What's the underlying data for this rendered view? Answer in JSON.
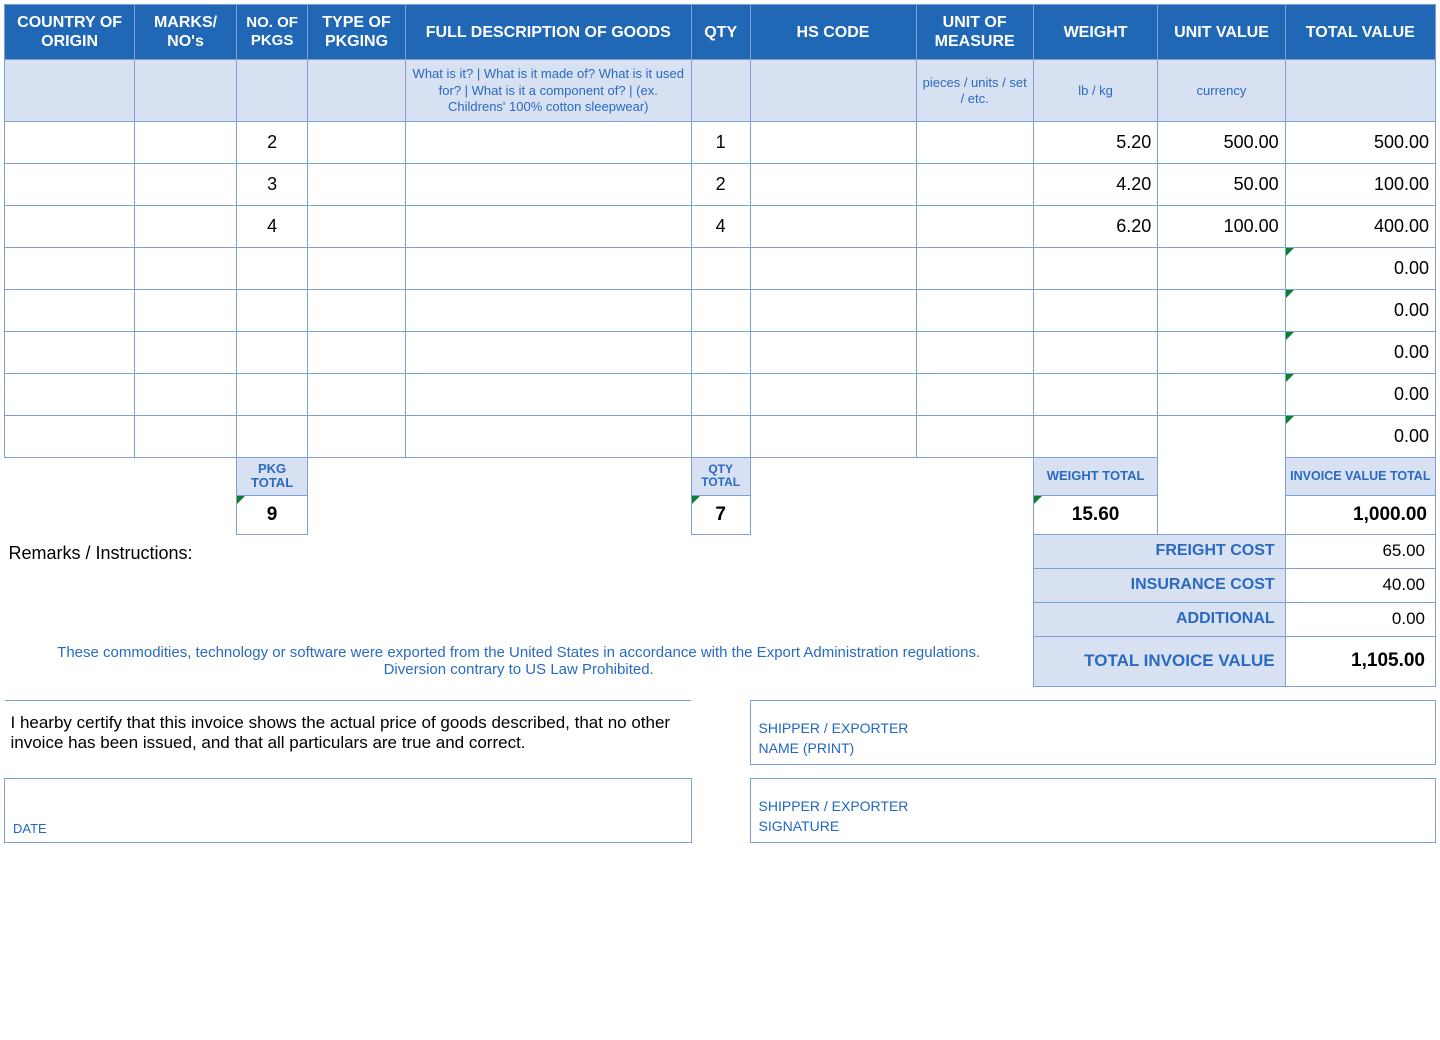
{
  "headers": {
    "country": "COUNTRY OF ORIGIN",
    "marks": "MARKS/ NO's",
    "pkgs": "NO. OF PKGS",
    "pkging": "TYPE OF PKGING",
    "desc": "FULL DESCRIPTION OF GOODS",
    "qty": "QTY",
    "hs": "HS CODE",
    "uom": "UNIT OF MEASURE",
    "weight": "WEIGHT",
    "unitval": "UNIT VALUE",
    "totalval": "TOTAL VALUE"
  },
  "hints": {
    "desc": "What is it? | What is it made of? What is it used for? | What is it a component of? | (ex. Childrens' 100% cotton sleepwear)",
    "uom": "pieces / units / set / etc.",
    "weight": "lb / kg",
    "unitval": "currency"
  },
  "rows": [
    {
      "pkgs": "2",
      "qty": "1",
      "weight": "5.20",
      "unitval": "500.00",
      "totalval": "500.00"
    },
    {
      "pkgs": "3",
      "qty": "2",
      "weight": "4.20",
      "unitval": "50.00",
      "totalval": "100.00"
    },
    {
      "pkgs": "4",
      "qty": "4",
      "weight": "6.20",
      "unitval": "100.00",
      "totalval": "400.00"
    },
    {
      "totalval": "0.00"
    },
    {
      "totalval": "0.00"
    },
    {
      "totalval": "0.00"
    },
    {
      "totalval": "0.00"
    },
    {
      "totalval": "0.00"
    }
  ],
  "totals": {
    "pkg_label": "PKG TOTAL",
    "qty_label": "QTY TOTAL",
    "weight_label": "WEIGHT TOTAL",
    "invval_label": "INVOICE VALUE TOTAL",
    "pkg": "9",
    "qty": "7",
    "weight": "15.60",
    "invval": "1,000.00"
  },
  "summary": {
    "freight_label": "FREIGHT COST",
    "freight": "65.00",
    "insurance_label": "INSURANCE COST",
    "insurance": "40.00",
    "additional_label": "ADDITIONAL",
    "additional": "0.00",
    "total_label": "TOTAL INVOICE VALUE",
    "total": "1,105.00"
  },
  "text": {
    "remarks": "Remarks / Instructions:",
    "disclaimer": "These commodities, technology or software were exported from the United States in accordance with the Export Administration regulations.  Diversion contrary to US Law Prohibited.",
    "certify": "I hearby certify that this invoice shows the actual price of goods described, that no other invoice has been issued, and that all particulars are true and correct.",
    "shipper_name_l1": "SHIPPER / EXPORTER",
    "shipper_name_l2": "NAME (PRINT)",
    "shipper_sig_l1": "SHIPPER / EXPORTER",
    "shipper_sig_l2": "SIGNATURE",
    "date": "DATE"
  }
}
